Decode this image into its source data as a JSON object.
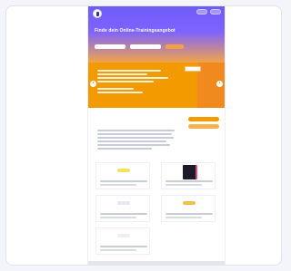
{
  "site": {
    "title": "Finde dein Online-Trainingsangebot",
    "search": {
      "placeholder": "",
      "button_label": ""
    }
  },
  "colors": {
    "hero_top": "#6f5cf5",
    "hero_bottom": "#f1a44a",
    "banner": "#f39a00",
    "accent": "#f08a1e"
  },
  "banner": {
    "slides": []
  },
  "about": {
    "heading": ""
  },
  "tiles": [
    {
      "thumb_color": "#f5e45a"
    },
    {
      "thumb_color": "#1b1b2b"
    },
    {
      "thumb_color": "#e6e9ef"
    },
    {
      "thumb_color": "#f1c24a"
    },
    {
      "thumb_color": "#eeeeee"
    }
  ]
}
